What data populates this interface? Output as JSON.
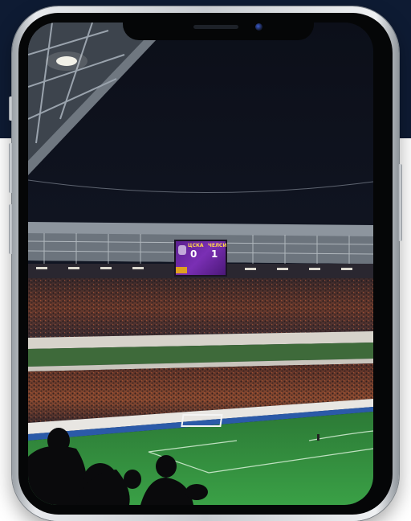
{
  "scoreboard": {
    "home_name": "ЦСКА",
    "away_name": "ЧЕЛСИ",
    "home_score": "0",
    "away_score": "1"
  },
  "colors": {
    "background_band": "#0e1b33",
    "phone_frame": "#c8ccd1",
    "scoreboard": "#7a2fb4",
    "pitch": "#2f8a3c",
    "seats": "#c0522a"
  },
  "icons": [
    "front-camera-icon",
    "earpiece-speaker-icon"
  ]
}
